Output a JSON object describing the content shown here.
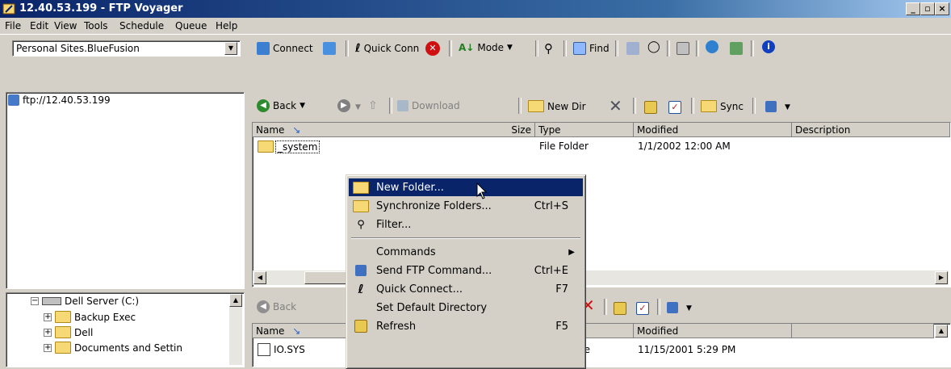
{
  "window": {
    "title": "12.40.53.199 - FTP Voyager",
    "min_label": "_",
    "max_label": "▫",
    "close_label": "×"
  },
  "menu": [
    "File",
    "Edit",
    "View",
    "Tools",
    "Schedule",
    "Queue",
    "Help"
  ],
  "toolbar": {
    "site_select": "Personal Sites.BlueFusion",
    "connect_label": "Connect",
    "quickconn_label": "Quick Conn",
    "mode_label": "Mode",
    "find_label": "Find"
  },
  "remote": {
    "address": "ftp://12.40.53.199",
    "back_label": "Back",
    "download_label": "Download",
    "newdir_label": "New Dir",
    "sync_label": "Sync",
    "columns": [
      "Name",
      "Size",
      "Type",
      "Modified",
      "Description"
    ],
    "rows": [
      {
        "name": "_system",
        "size": "",
        "type": "File Folder",
        "modified": "1/1/2002 12:00 AM",
        "description": ""
      }
    ]
  },
  "local": {
    "tree": [
      "Dell Server (C:)",
      "Backup Exec",
      "Dell",
      "Documents and Settin"
    ],
    "back_label": "Back",
    "columns": [
      "Name",
      "Modified"
    ],
    "rows": [
      {
        "name": "IO.SYS",
        "type_fragment": "ile",
        "modified": "11/15/2001 5:29 PM"
      }
    ]
  },
  "context_menu": {
    "items": [
      {
        "label": "New Folder...",
        "shortcut": ""
      },
      {
        "label": "Synchronize Folders...",
        "shortcut": "Ctrl+S"
      },
      {
        "label": "Filter...",
        "shortcut": ""
      },
      {
        "label": "Commands",
        "shortcut": "▶"
      },
      {
        "label": "Send FTP Command...",
        "shortcut": "Ctrl+E"
      },
      {
        "label": "Quick Connect...",
        "shortcut": "F7"
      },
      {
        "label": "Set Default Directory",
        "shortcut": ""
      },
      {
        "label": "Refresh",
        "shortcut": "F5"
      }
    ]
  },
  "colors": {
    "titlebar": "#0a246a",
    "highlight": "#0a246a",
    "face": "#d4d0c8"
  }
}
